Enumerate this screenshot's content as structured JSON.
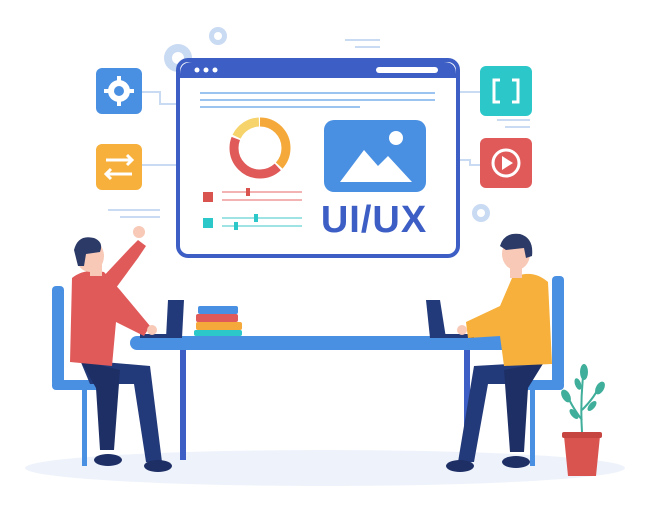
{
  "illustration": {
    "headline": "UI/UX",
    "colors": {
      "primary_blue": "#3D5FC5",
      "light_blue": "#7EB6F0",
      "panel_border": "#3D5FC5",
      "red": "#E05A5A",
      "orange": "#F5A93A",
      "teal": "#2CC7C9",
      "yellow": "#F6B03B",
      "navy": "#233A7A",
      "skin": "#F7C9B6",
      "hair": "#2B3A67",
      "table": "#4A90E2",
      "plant": "#3FAE9A",
      "pot": "#D9534F"
    },
    "icons": {
      "left_top": "gear-icon",
      "left_bottom": "swap-arrows-icon",
      "right_top": "code-brackets-icon",
      "right_bottom": "play-icon",
      "panel_image": "image-placeholder-icon",
      "panel_chart": "donut-chart-icon"
    }
  }
}
